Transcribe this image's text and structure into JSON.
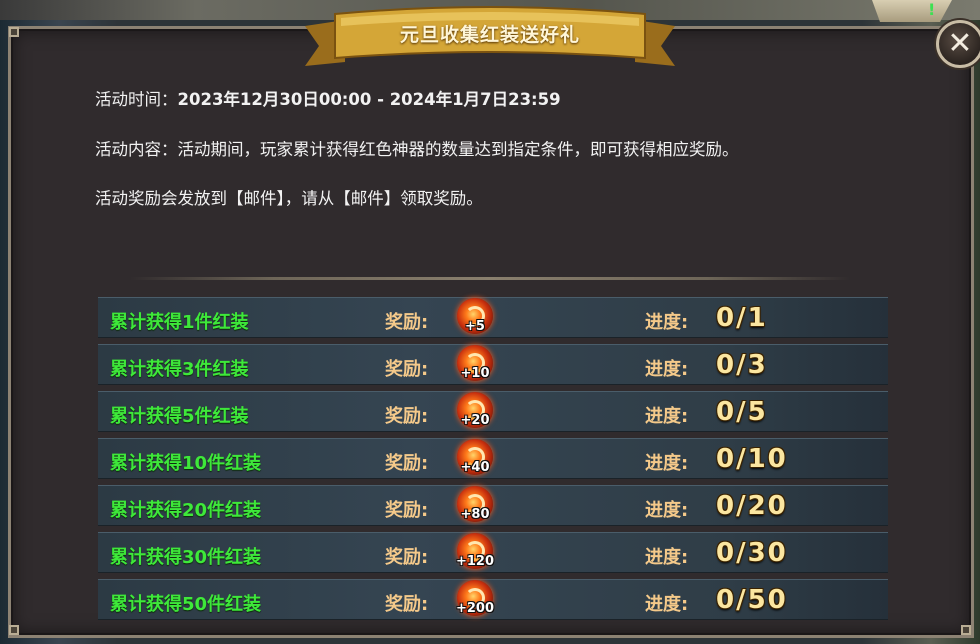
{
  "window": {
    "title": "元旦收集红装送好礼",
    "close_symbol": "✕"
  },
  "info": {
    "time_label": "活动时间：",
    "time_value": "2023年12月30日00:00 - 2024年1月7日23:59",
    "content": "活动内容：活动期间，玩家累计获得红色神器的数量达到指定条件，即可获得相应奖励。",
    "mail_note": "活动奖励会发放到【邮件】，请从【邮件】领取奖励。"
  },
  "labels": {
    "reward": "奖励:",
    "progress": "进度:"
  },
  "rewards": [
    {
      "condition": "累计获得1件红装",
      "item_icon": "red-gem-swirl-icon",
      "qty": "+5",
      "progress": "0/1"
    },
    {
      "condition": "累计获得3件红装",
      "item_icon": "red-gem-swirl-icon",
      "qty": "+10",
      "progress": "0/3"
    },
    {
      "condition": "累计获得5件红装",
      "item_icon": "red-gem-swirl-icon",
      "qty": "+20",
      "progress": "0/5"
    },
    {
      "condition": "累计获得10件红装",
      "item_icon": "red-gem-swirl-icon",
      "qty": "+40",
      "progress": "0/10"
    },
    {
      "condition": "累计获得20件红装",
      "item_icon": "red-gem-swirl-icon",
      "qty": "+80",
      "progress": "0/20"
    },
    {
      "condition": "累计获得30件红装",
      "item_icon": "red-gem-swirl-icon",
      "qty": "+120",
      "progress": "0/30"
    },
    {
      "condition": "累计获得50件红装",
      "item_icon": "red-gem-swirl-icon",
      "qty": "+200",
      "progress": "0/50"
    }
  ],
  "colors": {
    "condition_text": "#3ee83a",
    "label_text": "#f4c98a",
    "progress_text": "#fbe6a0",
    "panel_bg": "#302b2d",
    "ribbon_gold": "#d4a637"
  }
}
